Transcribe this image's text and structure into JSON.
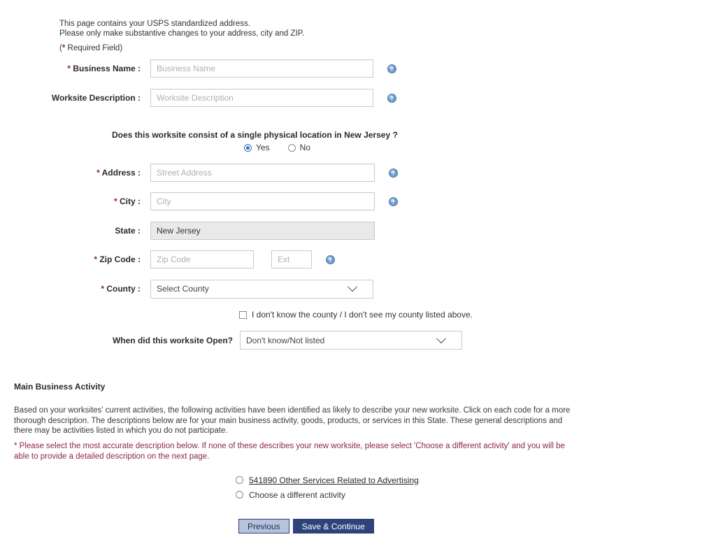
{
  "intro": {
    "line1": "This page contains your USPS standardized address.",
    "line2": "Please only make substantive changes to your address, city and ZIP.",
    "required_prefix": "(",
    "required_asterisk": "*",
    "required_text": " Required Field)"
  },
  "form": {
    "business_name": {
      "label": "Business Name :",
      "required": true,
      "placeholder": "Business Name",
      "value": "",
      "help_icon": "help-circle-icon"
    },
    "worksite_description": {
      "label": "Worksite Description :",
      "required": false,
      "placeholder": "Worksite Description",
      "value": "",
      "help_icon": "help-circle-icon"
    },
    "single_location_question": {
      "text": "Does this worksite consist of a single physical location in New Jersey ?",
      "options": [
        "Yes",
        "No"
      ],
      "selected": "Yes"
    },
    "address": {
      "label": "Address :",
      "required": true,
      "placeholder": "Street Address",
      "value": "",
      "help_icon": "help-circle-icon"
    },
    "city": {
      "label": "City :",
      "required": true,
      "placeholder": "City",
      "value": "",
      "help_icon": "help-circle-icon"
    },
    "state": {
      "label": "State :",
      "required": false,
      "value": "New Jersey",
      "readonly": true
    },
    "zip_code": {
      "label": "Zip Code :",
      "required": true,
      "placeholder": "Zip Code",
      "value": "",
      "ext_placeholder": "Ext",
      "ext_value": "",
      "help_icon": "help-circle-icon"
    },
    "county": {
      "label": "County :",
      "required": true,
      "selected": "Select County",
      "options": [
        "Select County"
      ]
    },
    "county_unknown": {
      "label": "I don't know the county / I don't see my county listed above.",
      "checked": false
    },
    "worksite_open": {
      "label": "When did this worksite Open?",
      "selected": "Don't know/Not listed",
      "options": [
        "Don't know/Not listed"
      ]
    }
  },
  "main_business_activity": {
    "title": "Main Business Activity",
    "description": "Based on your worksites' current activities, the following activities have been identified as likely to describe your new worksite. Click on each code for a more thorough description. The descriptions below are for your main business activity, goods, products, or services in this State. These general descriptions and there may be activities listed in which you do not participate.",
    "select_note_asterisk": "*",
    "select_note": " Please select the most accurate description below. If none of these describes your new worksite, please select 'Choose a different activity' and you will be able to provide a detailed description on the next page.",
    "activities": [
      {
        "label": "541890 Other Services Related to Advertising",
        "is_link": true,
        "selected": false
      },
      {
        "label": "Choose a different activity",
        "is_link": false,
        "selected": false
      }
    ]
  },
  "buttons": {
    "previous": "Previous",
    "save_continue": "Save & Continue"
  },
  "colors": {
    "required_red": "#8d2741",
    "accent_blue": "#2f6fb5",
    "btn_primary_bg": "#2e4379",
    "btn_secondary_bg": "#b7c3dd",
    "readonly_bg": "#e9e9e9"
  }
}
